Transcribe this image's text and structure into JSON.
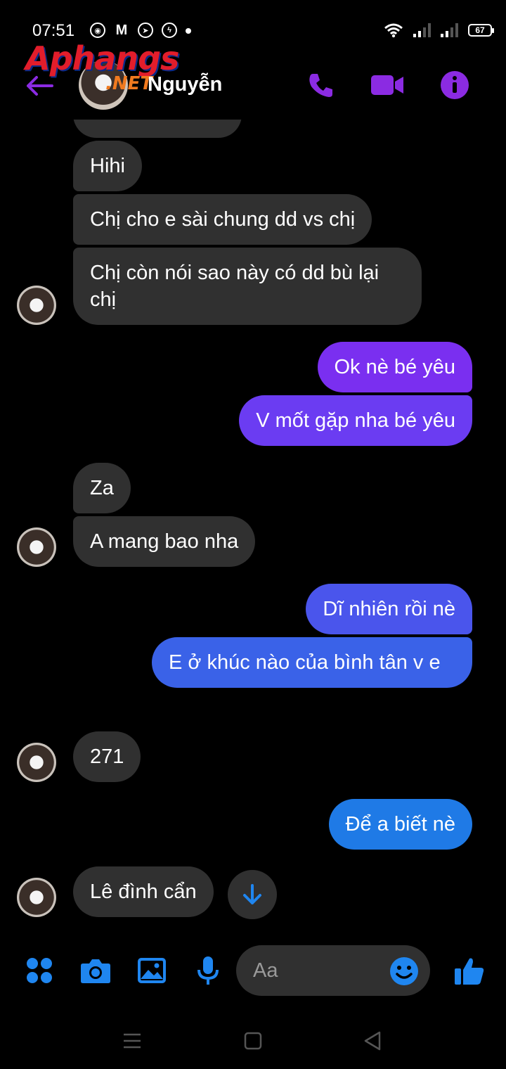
{
  "status_bar": {
    "time": "07:51",
    "battery": "67",
    "notification_icons": [
      "chrome-icon",
      "gmail-icon",
      "telegram-icon",
      "messenger-icon"
    ]
  },
  "header": {
    "contact_name": "Nguyễn",
    "watermark_main": "Aphangs",
    "watermark_sub": ".NET",
    "accent_color": "#8b2be2"
  },
  "messages": [
    {
      "side": "in",
      "text": "Hihi"
    },
    {
      "side": "in",
      "text": "Chị cho e sài chung dd vs chị"
    },
    {
      "side": "in",
      "text": "Chị còn nói sao này có dd bù lại chị"
    },
    {
      "side": "out",
      "text": "Ok nè bé yêu"
    },
    {
      "side": "out",
      "text": "V mốt gặp nha bé yêu"
    },
    {
      "side": "in",
      "text": "Za"
    },
    {
      "side": "in",
      "text": "A mang bao nha"
    },
    {
      "side": "out",
      "text": "Dĩ nhiên rồi nè"
    },
    {
      "side": "out",
      "text": "E ở khúc nào của bình tân v e"
    },
    {
      "side": "in",
      "text": "271"
    },
    {
      "side": "out",
      "text": "Để a biết nè"
    },
    {
      "side": "in",
      "text": "Lê đình cẩn"
    }
  ],
  "composer": {
    "placeholder": "Aa"
  },
  "colors": {
    "incoming_bubble": "#303030",
    "outgoing_purple": "#7a2ff0",
    "outgoing_blue": "#3a62e8",
    "outgoing_light_blue": "#1f7ae6",
    "icon_blue": "#1f86f0",
    "icon_purple": "#8b2be2"
  }
}
